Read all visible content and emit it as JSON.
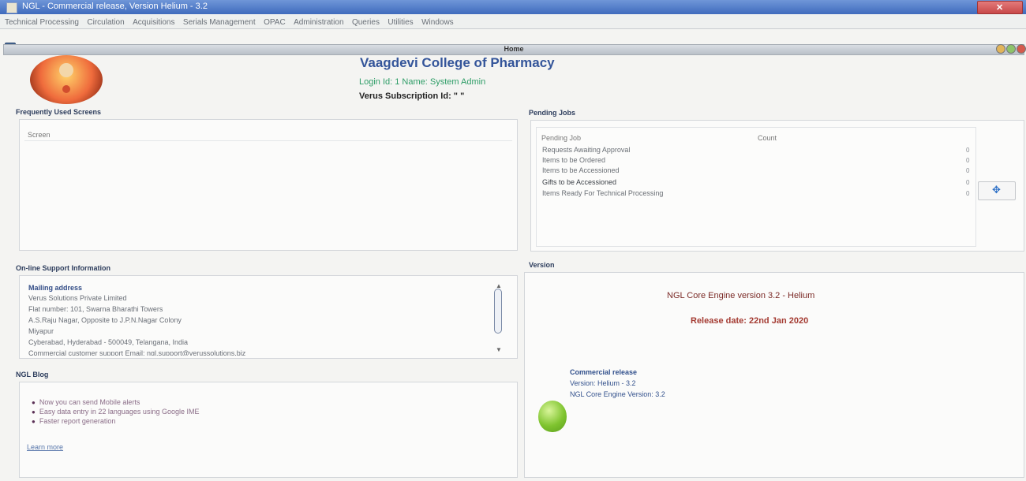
{
  "window": {
    "title": "NGL - Commercial release, Version Helium - 3.2"
  },
  "menu": [
    "Technical Processing",
    "Circulation",
    "Acquisitions",
    "Serials Management",
    "OPAC",
    "Administration",
    "Queries",
    "Utilities",
    "Windows"
  ],
  "home": {
    "title": "Home",
    "college": "Vaagdevi College of Pharmacy",
    "login_line": "Login Id: 1    Name: System Admin",
    "subscription": "Verus Subscription Id: \" \""
  },
  "frequent": {
    "heading": "Frequently Used Screens",
    "column": "Screen"
  },
  "pending": {
    "heading": "Pending Jobs",
    "col_job": "Pending Job",
    "col_count": "Count",
    "rows": [
      {
        "job": "Requests Awaiting Approval",
        "count": "0"
      },
      {
        "job": "Items to be Ordered",
        "count": "0"
      },
      {
        "job": "Items to be Accessioned",
        "count": "0"
      },
      {
        "job": "Gifts to be Accessioned",
        "count": "0"
      },
      {
        "job": "Items Ready For Technical Processing",
        "count": "0"
      }
    ]
  },
  "support": {
    "heading": "On-line Support Information",
    "mailing_heading": "Mailing address",
    "lines": [
      "Verus Solutions Private Limited",
      "Flat number: 101, Swarna Bharathi Towers",
      "A.S.Raju Nagar, Opposite to J.P.N.Nagar Colony",
      "Miyapur",
      "Cyberabad, Hyderabad - 500049, Telangana, India",
      "Commercial customer support Email: ngl.support@verussolutions.biz"
    ]
  },
  "blog": {
    "heading": "NGL Blog",
    "items": [
      "Now you can send Mobile alerts",
      "Easy data entry in 22 languages using Google IME",
      "Faster report generation"
    ],
    "learn_more": "Learn more"
  },
  "version": {
    "heading": "Version",
    "engine": "NGL Core Engine version 3.2 - Helium",
    "release_date": "Release date: 22nd Jan 2020",
    "release_type": "Commercial release",
    "version_line": "Version: Helium - 3.2",
    "engine_version_line": "NGL Core Engine Version: 3.2"
  }
}
